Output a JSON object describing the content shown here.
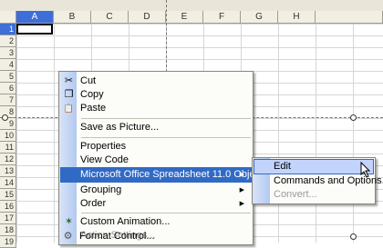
{
  "columns": [
    "A",
    "B",
    "C",
    "D",
    "E",
    "F",
    "G",
    "H"
  ],
  "rows": [
    "1",
    "2",
    "3",
    "4",
    "5",
    "6",
    "7",
    "8",
    "9",
    "10",
    "11",
    "12",
    "13",
    "14",
    "15",
    "16",
    "17",
    "18",
    "19",
    "20"
  ],
  "context_menu": {
    "items": [
      {
        "label": "Cut",
        "icon": "scissors-icon",
        "glyph": "✂",
        "disabled": false
      },
      {
        "label": "Copy",
        "icon": "copy-icon",
        "glyph": "❐",
        "disabled": false
      },
      {
        "label": "Paste",
        "icon": "paste-icon",
        "glyph": "📋",
        "disabled": false
      },
      {
        "label": "Save as Picture...",
        "disabled": false
      },
      {
        "label": "Properties",
        "disabled": false
      },
      {
        "label": "View Code",
        "disabled": false
      },
      {
        "label": "Microsoft Office Spreadsheet 11.0 Object",
        "selected": true,
        "submenu": true
      },
      {
        "label": "Grouping",
        "submenu": true,
        "disabled": false
      },
      {
        "label": "Order",
        "submenu": true,
        "disabled": false
      },
      {
        "label": "Custom Animation...",
        "icon": "animation-icon",
        "glyph": "✶",
        "disabled": false
      },
      {
        "label": "Action Settings...",
        "disabled": true
      },
      {
        "label": "Format Control...",
        "icon": "format-control-icon",
        "glyph": "⚙",
        "disabled": false
      }
    ]
  },
  "submenu": {
    "items": [
      {
        "label": "Edit",
        "highlighted": true
      },
      {
        "label": "Commands and Options...",
        "disabled": false
      },
      {
        "label": "Convert...",
        "disabled": true
      }
    ]
  },
  "colors": {
    "accent": "#316ac5",
    "menu_strip": "#b3c9f0",
    "header": "#f1efe2"
  }
}
